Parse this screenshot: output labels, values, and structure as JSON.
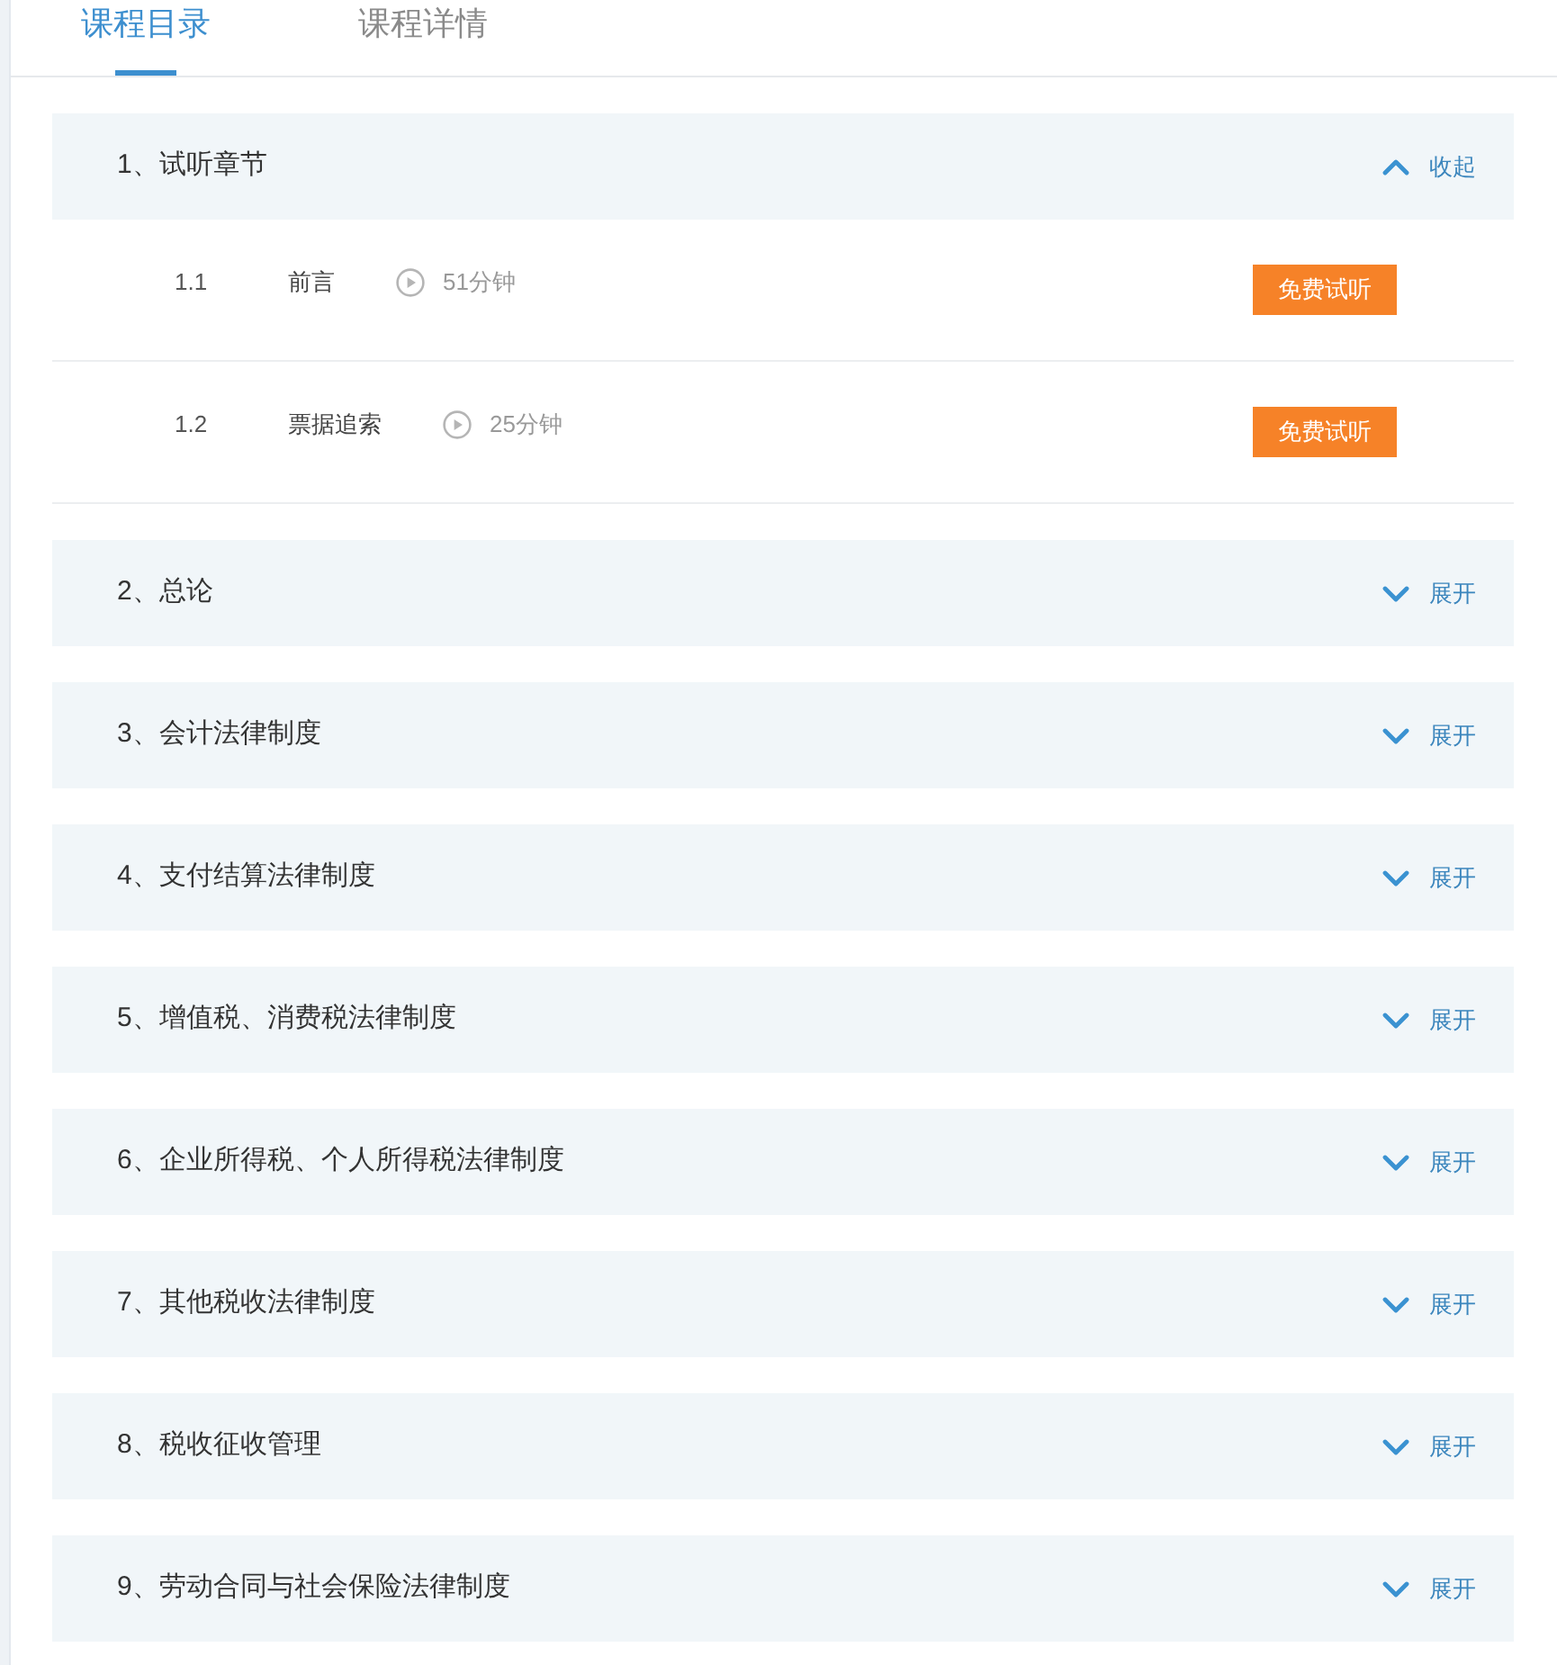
{
  "tabs": [
    {
      "label": "课程目录",
      "selected": true
    },
    {
      "label": "课程详情",
      "selected": false
    }
  ],
  "chapters": [
    {
      "title": "1、试听章节",
      "expanded": true,
      "toggle_label": "收起",
      "lessons": [
        {
          "number": "1.1",
          "title": "前言",
          "duration": "51分钟",
          "button": "免费试听"
        },
        {
          "number": "1.2",
          "title": "票据追索",
          "duration": "25分钟",
          "button": "免费试听"
        }
      ]
    },
    {
      "title": "2、总论",
      "expanded": false,
      "toggle_label": "展开"
    },
    {
      "title": "3、会计法律制度",
      "expanded": false,
      "toggle_label": "展开"
    },
    {
      "title": "4、支付结算法律制度",
      "expanded": false,
      "toggle_label": "展开"
    },
    {
      "title": "5、增值税、消费税法律制度",
      "expanded": false,
      "toggle_label": "展开"
    },
    {
      "title": "6、企业所得税、个人所得税法律制度",
      "expanded": false,
      "toggle_label": "展开"
    },
    {
      "title": "7、其他税收法律制度",
      "expanded": false,
      "toggle_label": "展开"
    },
    {
      "title": "8、税收征收管理",
      "expanded": false,
      "toggle_label": "展开"
    },
    {
      "title": "9、劳动合同与社会保险法律制度",
      "expanded": false,
      "toggle_label": "展开"
    }
  ]
}
